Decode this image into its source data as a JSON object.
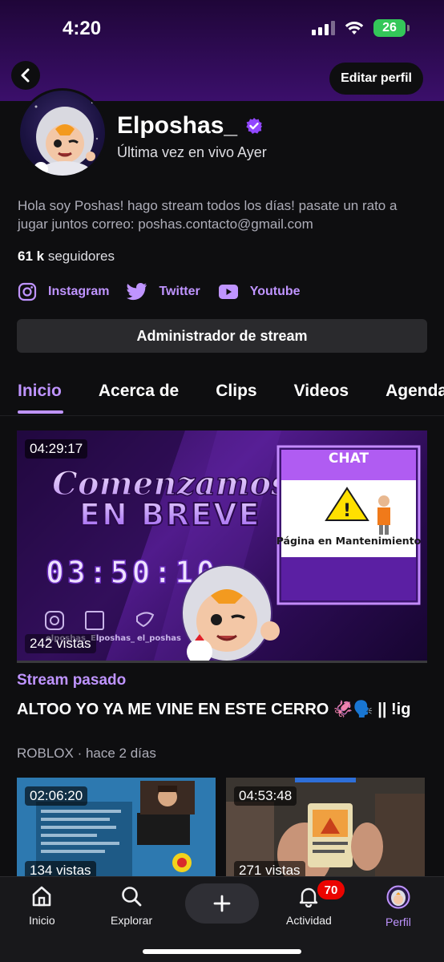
{
  "status_bar": {
    "time": "4:20",
    "battery": "26"
  },
  "header": {
    "edit_label": "Editar perfil"
  },
  "profile": {
    "name": "Elposhas_",
    "last_live": "Última vez en vivo Ayer",
    "bio": "Hola soy Poshas! hago stream todos los días! pasate un rato a jugar juntos correo: poshas.contacto@gmail.com",
    "followers_count": "61 k",
    "followers_label": "seguidores"
  },
  "socials": [
    {
      "label": "Instagram",
      "icon": "instagram-icon"
    },
    {
      "label": "Twitter",
      "icon": "twitter-icon"
    },
    {
      "label": "Youtube",
      "icon": "youtube-icon"
    }
  ],
  "admin_button": "Administrador de stream",
  "tabs": [
    {
      "label": "Inicio",
      "active": true
    },
    {
      "label": "Acerca de",
      "active": false
    },
    {
      "label": "Clips",
      "active": false
    },
    {
      "label": "Videos",
      "active": false
    },
    {
      "label": "Agenda",
      "active": false
    }
  ],
  "featured": {
    "duration": "04:29:17",
    "views": "242 vistas",
    "overlay_text": {
      "line1": "Comenzamos",
      "line2": "EN BREVE",
      "countdown": "03:50:10",
      "chat_title": "CHAT",
      "chat_status": "Página en Mantenimiento",
      "handles": [
        "elposhas",
        "Elposhas_",
        "el_poshas"
      ]
    },
    "label": "Stream pasado",
    "title": "ALTOO YO YA ME VINE EN ESTE CERRO 🦑🗣️ || !ig",
    "meta": "ROBLOX · hace 2 días"
  },
  "videos": [
    {
      "duration": "02:06:20",
      "views": "134 vistas"
    },
    {
      "duration": "04:53:48",
      "views": "271 vistas"
    }
  ],
  "bottom_nav": {
    "home": "Inicio",
    "explore": "Explorar",
    "activity": "Actividad",
    "profile": "Perfil",
    "notification_count": "70"
  },
  "colors": {
    "accent": "#bf94ff",
    "header_bg": "#3b0f6b",
    "notification": "#eb0400",
    "battery": "#34c759"
  }
}
